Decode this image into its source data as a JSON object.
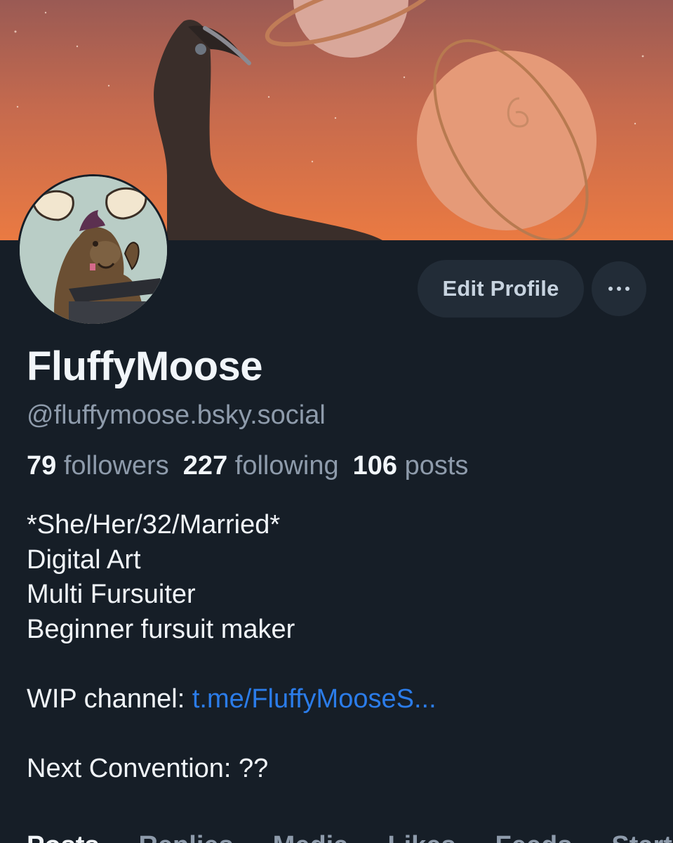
{
  "profile": {
    "display_name": "FluffyMoose",
    "handle": "@fluffymoose.bsky.social",
    "followers_count": "79",
    "followers_label": "followers",
    "following_count": "227",
    "following_label": "following",
    "posts_count": "106",
    "posts_label": "posts"
  },
  "actions": {
    "edit_label": "Edit Profile",
    "more_icon": "ellipsis-icon"
  },
  "bio": {
    "line1": "*She/Her/32/Married*",
    "line2": "Digital Art",
    "line3": "Multi Fursuiter",
    "line4": "Beginner fursuit maker",
    "wip_label": "WIP channel: ",
    "wip_link": "t.me/FluffyMooseS...",
    "convention": "Next Convention: ??"
  },
  "tabs": [
    "Posts",
    "Replies",
    "Media",
    "Likes",
    "Feeds",
    "Starter Packs"
  ],
  "colors": {
    "background": "#161e27",
    "button_bg": "#222c37",
    "link": "#2b7ce9",
    "muted_text": "#8e9bab",
    "primary_text": "#f1f5f9"
  }
}
